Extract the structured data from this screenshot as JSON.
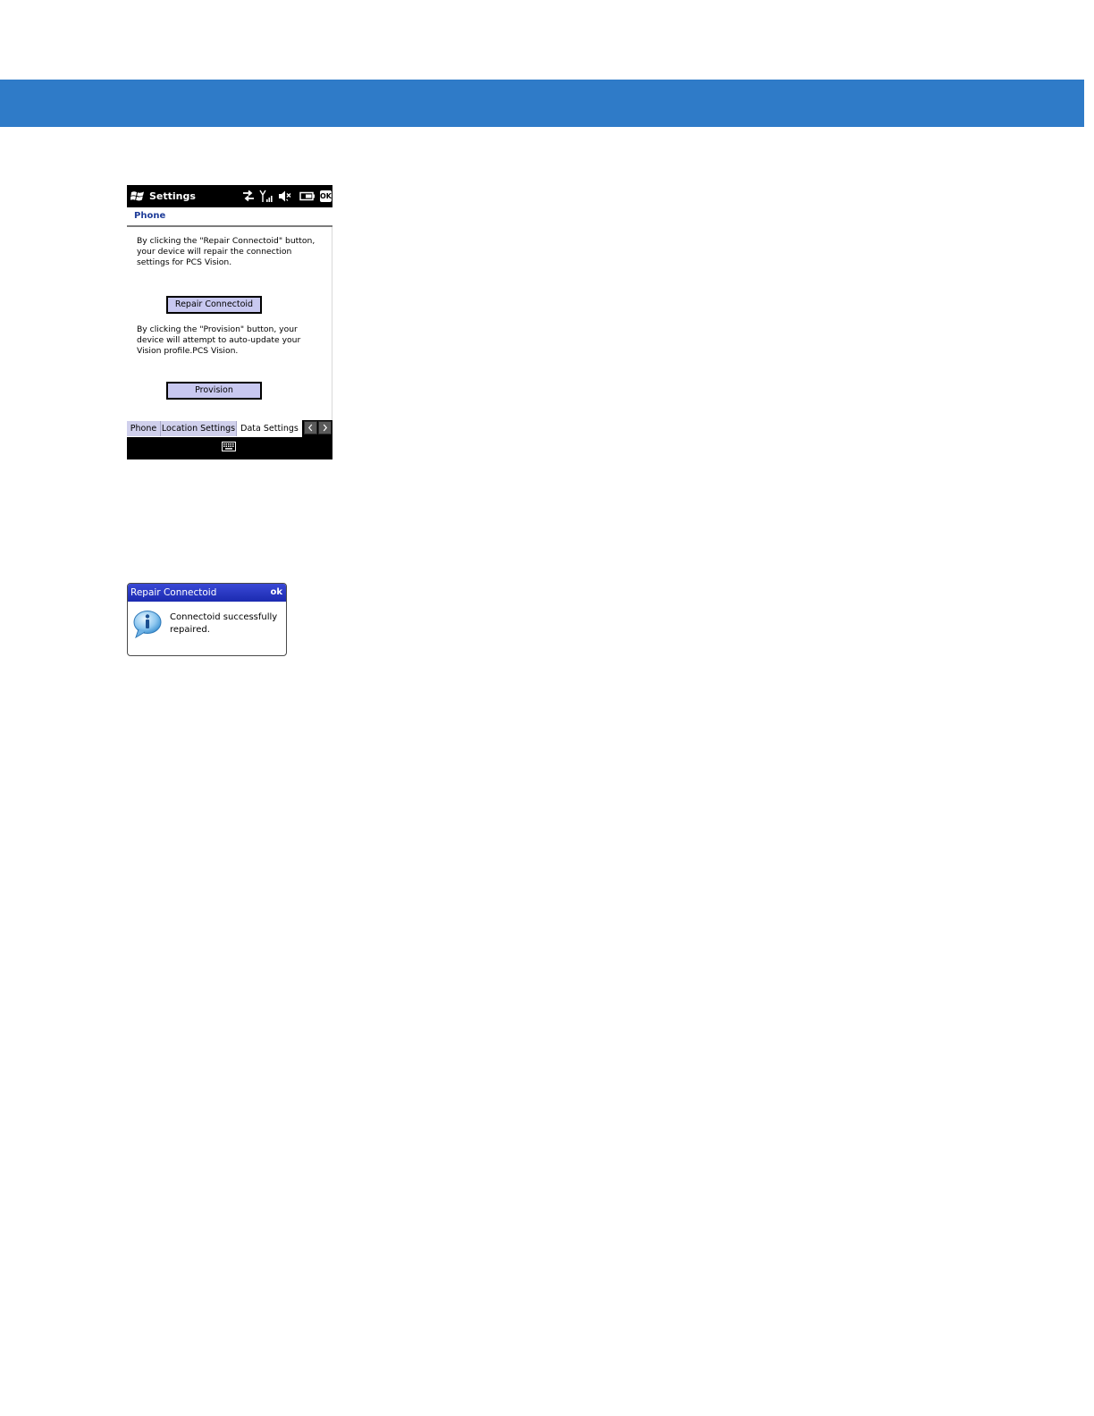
{
  "page": {
    "band_color": "#2f7bc8"
  },
  "phone": {
    "title": "Settings",
    "ok_label": "OK",
    "page_title": "Phone",
    "repair_text": "By clicking the \"Repair Connectoid\" button, your device will repair the connection settings for PCS Vision.",
    "repair_button": "Repair Connectoid",
    "provision_text": "By clicking the \"Provision\" button, your device will attempt to auto-update your Vision profile.PCS Vision.",
    "provision_button": "Provision",
    "tabs": [
      {
        "label": "Phone",
        "active": false
      },
      {
        "label": "Location Settings",
        "active": false
      },
      {
        "label": "Data Settings",
        "active": true
      }
    ],
    "icons": [
      "windows-start-icon",
      "data-sync-icon",
      "signal-icon",
      "volume-muted-icon",
      "battery-icon",
      "keyboard-icon",
      "scroll-left-icon",
      "scroll-right-icon"
    ]
  },
  "dialog": {
    "title": "Repair Connectoid",
    "ok_label": "ok",
    "message": "Connectoid successfully repaired.",
    "icon": "info-icon",
    "title_color": "#2535c4"
  }
}
